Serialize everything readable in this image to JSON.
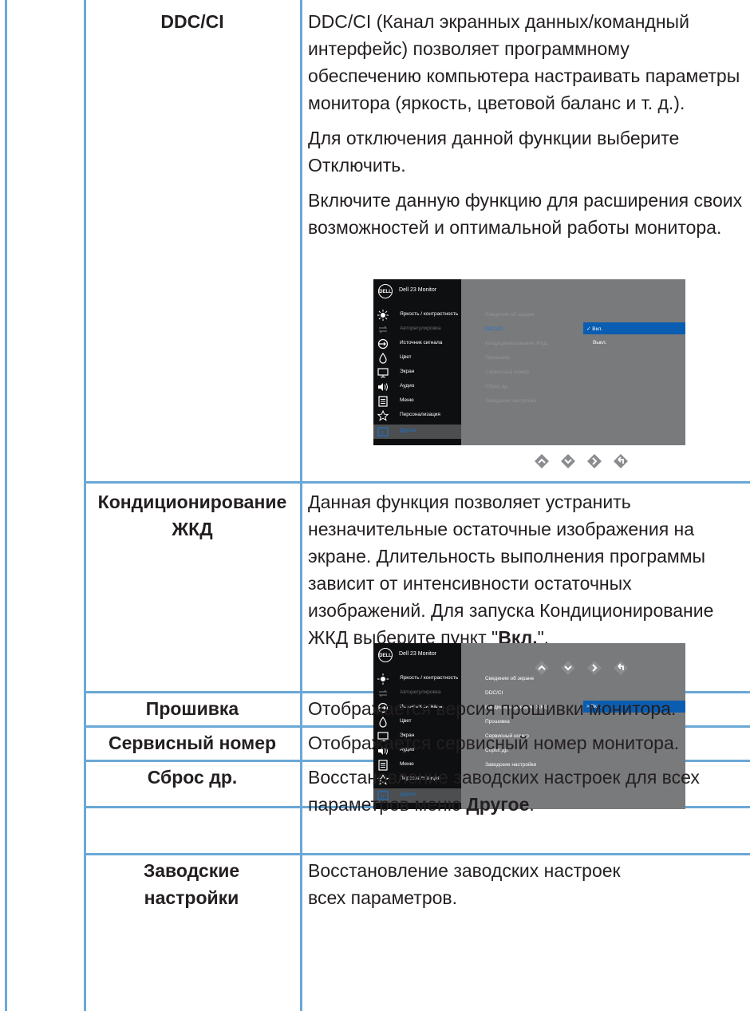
{
  "rows": [
    {
      "label": "DDC/CI",
      "paragraphs": [
        "DDC/CI (Канал экранных данных/командный интерфейс) позволяет программному обеспечению компьютера настраивать параметры монитора (яркость, цветовой баланс и т. д.).",
        "Для отключения данной функции выберите Отключить.",
        "Включите данную функцию для расширения своих возможностей и оптимальной работы монитора."
      ],
      "osd": {
        "title": "Dell 23 Monitor",
        "logo": "DELL",
        "menu": [
          "Яркость / контрастность",
          "Авторегулировка",
          "Источник сигнала",
          "Цвет",
          "Экран",
          "Аудио",
          "Меню",
          "Персонализация",
          "Другое"
        ],
        "submenu": [
          "Сведения об экране",
          "DDC/CI",
          "Кондиционирование ЖКД",
          "Прошивка",
          "Сервисный номер",
          "Сброс др.",
          "Заводские настройки"
        ],
        "options": [
          "✓ Вкл.",
          "Выкл."
        ]
      }
    },
    {
      "label": "Кондиционирование ЖКД",
      "text_before_bold": "Данная функция позволяет устранить незначительные остаточные изображения на экране. Длительность выполнения программы зависит от интенсивности остаточных изображений. Для запуска Кондиционирование ЖКД выберите пункт \"",
      "bold": "Вкл.",
      "text_after_bold": "\".",
      "osd": {
        "title": "Dell 23 Monitor",
        "logo": "DELL",
        "options": [
          "> Вкл."
        ]
      }
    },
    {
      "label": "Прошивка",
      "text": "Отображается версия прошивки монитора."
    },
    {
      "label": "Сервисный номер",
      "text": "Отображается сервисный номер монитора."
    },
    {
      "label": "Сброс др.",
      "text_before_bold": "Восстановление заводских настроек для всех параметров меню ",
      "bold": "Другое",
      "text_after_bold": "."
    },
    {
      "label": "Заводские настройки",
      "text": "Восстановление заводских настроек всех параметров."
    }
  ],
  "colors": {
    "grid": "#6aa8d6",
    "osd_bg": "#797a7c",
    "osd_side": "#0e0f11",
    "osd_select": "#0b5db1",
    "osd_active_text": "#1c73c9"
  },
  "nav_icons": [
    "up-arrow-icon",
    "down-arrow-icon",
    "right-arrow-icon",
    "back-icon"
  ]
}
